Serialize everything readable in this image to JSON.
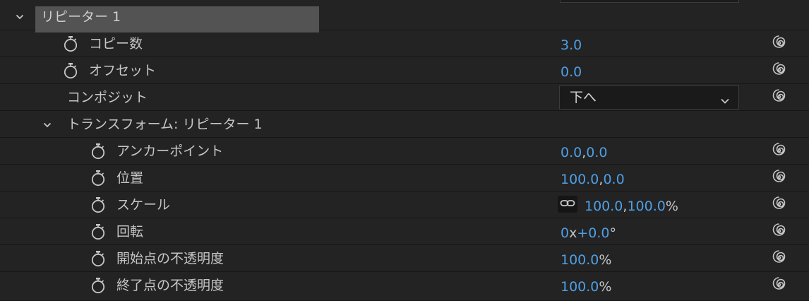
{
  "group": {
    "label": "リピーター 1"
  },
  "properties": {
    "copies": {
      "label": "コピー数",
      "value": "3.0"
    },
    "offset": {
      "label": "オフセット",
      "value": "0.0"
    },
    "composite": {
      "label": "コンポジット",
      "value": "下へ"
    }
  },
  "transform": {
    "label": "トランスフォーム: リピーター 1",
    "anchor_point": {
      "label": "アンカーポイント",
      "x": "0.0",
      "y": "0.0"
    },
    "position": {
      "label": "位置",
      "x": "100.0",
      "y": "0.0"
    },
    "scale": {
      "label": "スケール",
      "x": "100.0",
      "y": "100.0",
      "unit": "%"
    },
    "rotation": {
      "label": "回転",
      "turns": "0",
      "times": "x",
      "degrees": "+0.0",
      "deg_sign": "°"
    },
    "start_opacity": {
      "label": "開始点の不透明度",
      "value": "100.0",
      "unit": "%"
    },
    "end_opacity": {
      "label": "終了点の不透明度",
      "value": "100.0",
      "unit": "%"
    }
  },
  "separator": ",",
  "colors": {
    "background": "#232323",
    "value_blue": "#4f9fe6",
    "label_text": "#c6c6c6",
    "group_highlight": "#535353"
  },
  "icons": {
    "stopwatch": "stopwatch-icon",
    "expression": "spiral-icon",
    "chevron": "chevron-down-icon",
    "constrain": "link-icon"
  }
}
